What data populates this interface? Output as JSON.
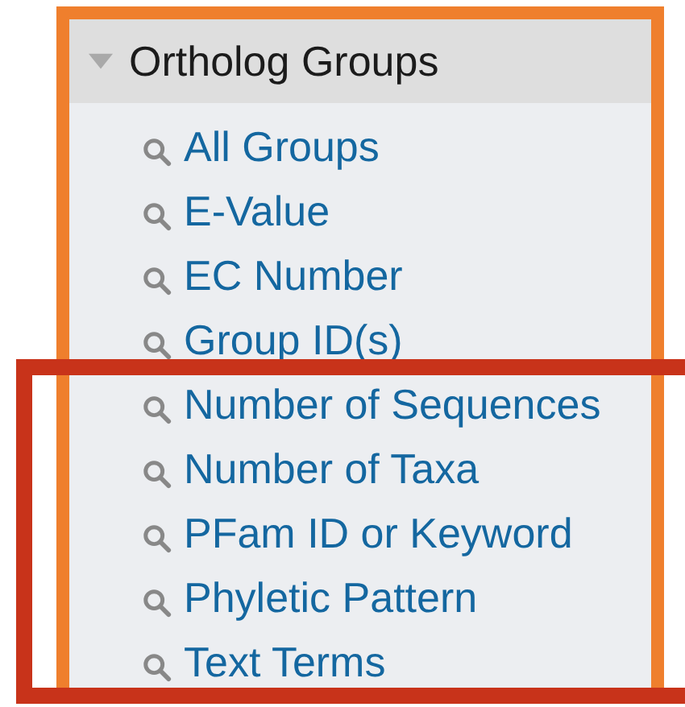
{
  "section": {
    "title": "Ortholog Groups",
    "expanded": true,
    "items": [
      "All Groups",
      "E-Value",
      "EC Number",
      "Group ID(s)",
      "Number of Sequences",
      "Number of Taxa",
      "PFam ID or Keyword",
      "Phyletic Pattern",
      "Text Terms"
    ]
  }
}
